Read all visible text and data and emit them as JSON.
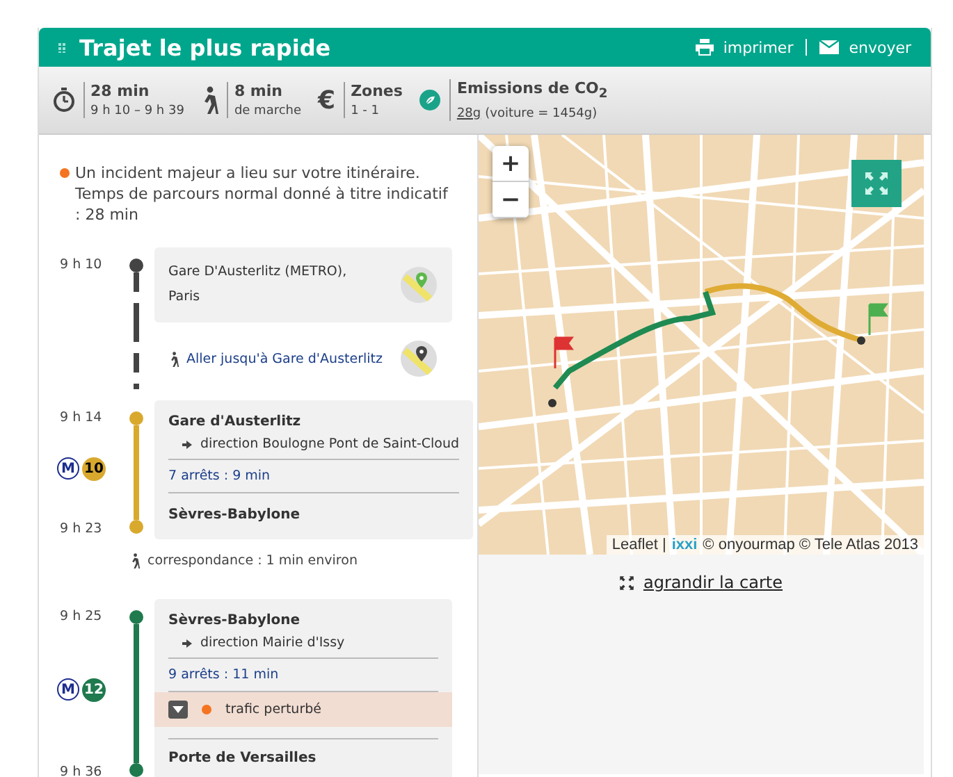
{
  "header": {
    "title": "Trajet le plus rapide",
    "actions": [
      {
        "kind": "print",
        "label": "imprimer"
      },
      {
        "kind": "mail",
        "label": "envoyer"
      }
    ]
  },
  "stats": [
    {
      "kind": "duration",
      "value": "28 min",
      "detail": "9 h 10 – 9 h 39"
    },
    {
      "kind": "walk",
      "value": "8 min",
      "detail": "de marche"
    },
    {
      "kind": "zones",
      "symbol": "€",
      "value": "Zones",
      "detail": "1 - 1"
    },
    {
      "kind": "co2",
      "value": "Emissions de CO$_{2}$",
      "link": "28g",
      "detail": "(voiture = 1454g)"
    }
  ],
  "alert": "Un incident majeur a lieu sur votre itinéraire. Temps de parcours normal donné à titre indicatif : 28 min",
  "steps": [
    {
      "kind": "stop",
      "time": "9 h 10",
      "name": "Gare D'Austerlitz (METRO), Paris"
    },
    {
      "kind": "walk",
      "text": "Aller jusqu'à Gare d'Austerlitz"
    },
    {
      "kind": "ride",
      "start_time": "9 h 14",
      "end_time": "9 h 23",
      "mode": "M",
      "line": "10",
      "color": "#d9a92e",
      "from": "Gare d'Austerlitz",
      "direction": "direction Boulogne Pont de Saint-Cloud",
      "stops": "7 arrêts : 9 min",
      "to": "Sèvres-Babylone"
    },
    {
      "kind": "transfer",
      "text": "correspondance : 1 min environ"
    },
    {
      "kind": "ride",
      "start_time": "9 h 25",
      "end_time": "9 h 36",
      "mode": "M",
      "line": "12",
      "color": "#1f7a4d",
      "from": "Sèvres-Babylone",
      "direction": "direction Mairie d'Issy",
      "stops": "9 arrêts : 11 min",
      "disruption": "trafic perturbé",
      "to": "Porte de Versailles"
    }
  ],
  "map": {
    "zoom_in": "+",
    "zoom_out": "−",
    "attribution": {
      "before": "Leaflet |",
      "brand": "ixxi",
      "after": "© onyourmap © Tele Atlas 2013"
    },
    "enlarge": "agrandir la carte"
  }
}
